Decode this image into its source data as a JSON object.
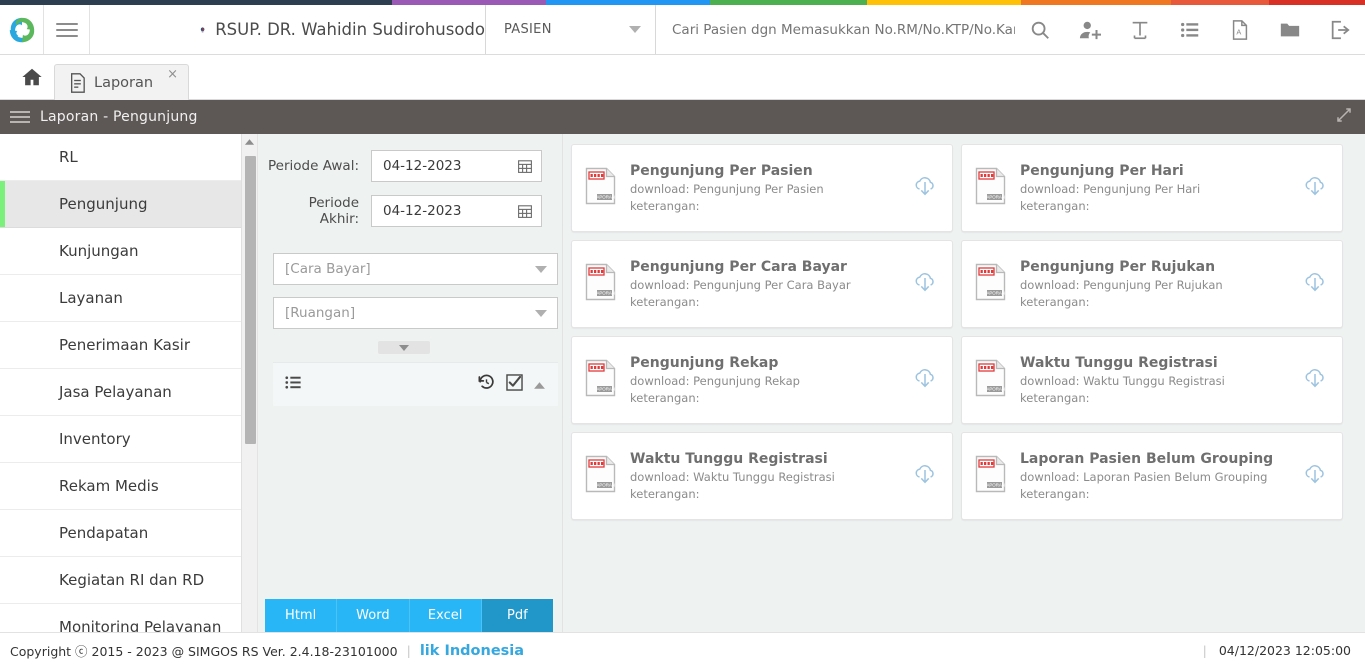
{
  "top_stripe_colors": [
    "#2c3e50",
    "#9b59b6",
    "#2196f3",
    "#4caf50",
    "#ffc107",
    "#ef7721",
    "#e8593c",
    "#d93025"
  ],
  "header": {
    "logo": "simgos-pinwheel-logo",
    "menu_toggle": "hamburger-icon",
    "hospital_name": "RSUP. DR. Wahidin Sudirohusodo",
    "search_category": "PASIEN",
    "search_placeholder": "Cari Pasien dgn Memasukkan No.RM/No.KTP/No.Kartu BPJS/",
    "icons": [
      {
        "name": "search-icon",
        "glyph": "search"
      },
      {
        "name": "add-user-icon",
        "glyph": "user-plus"
      },
      {
        "name": "text-tool-icon",
        "glyph": "text"
      },
      {
        "name": "list-icon",
        "glyph": "list"
      },
      {
        "name": "pdf-icon",
        "glyph": "pdf"
      },
      {
        "name": "folder-icon",
        "glyph": "folder"
      },
      {
        "name": "logout-icon",
        "glyph": "logout"
      }
    ]
  },
  "tabbar": {
    "home_icon": "home-icon",
    "tabs": [
      {
        "label": "Laporan",
        "icon": "document-icon",
        "close": "×",
        "active": true
      }
    ]
  },
  "breadcrumb": {
    "menu_icon": "hamburger-icon",
    "text": "Laporan - Pengunjung",
    "expand_icon": "expand-icon"
  },
  "sidebar": {
    "items": [
      {
        "label": "RL",
        "active": false
      },
      {
        "label": "Pengunjung",
        "active": true
      },
      {
        "label": "Kunjungan",
        "active": false
      },
      {
        "label": "Layanan",
        "active": false
      },
      {
        "label": "Penerimaan Kasir",
        "active": false
      },
      {
        "label": "Jasa Pelayanan",
        "active": false
      },
      {
        "label": "Inventory",
        "active": false
      },
      {
        "label": "Rekam Medis",
        "active": false
      },
      {
        "label": "Pendapatan",
        "active": false
      },
      {
        "label": "Kegiatan RI dan RD",
        "active": false
      },
      {
        "label": "Monitoring Pelayanan",
        "active": false
      }
    ],
    "active_accent_color": "#7bf07b",
    "scrollbar": {
      "up_icon": "chevron-up-icon",
      "down_icon": "chevron-down-icon"
    }
  },
  "filters": {
    "periode_awal_label": "Periode Awal:",
    "periode_awal_value": "04-12-2023",
    "periode_akhir_label": "Periode Akhir:",
    "periode_akhir_value": "04-12-2023",
    "calendar_icon": "calendar-icon",
    "cara_bayar_value": "[Cara Bayar]",
    "ruangan_value": "[Ruangan]",
    "dropdown_icon": "chevron-down-icon",
    "drag_handle_icon": "chevron-down-icon",
    "toolbar": {
      "list_icon": "list-icon",
      "reset_icon": "history-reset-icon",
      "check_icon": "checkbox-checked-icon",
      "collapse_icon": "chevron-up-icon"
    },
    "export_buttons": [
      {
        "label": "Html",
        "active": false
      },
      {
        "label": "Word",
        "active": false
      },
      {
        "label": "Excel",
        "active": false
      },
      {
        "label": "Pdf",
        "active": true
      }
    ]
  },
  "reports": {
    "download_prefix": "download: ",
    "keterangan_label": "keterangan:",
    "doc_icon": "report-document-icon",
    "download_icon": "cloud-download-icon",
    "cards": [
      {
        "title": "Pengunjung Per Pasien",
        "download": "download: Pengunjung Per Pasien",
        "keterangan": "keterangan:"
      },
      {
        "title": "Pengunjung Per Hari",
        "download": "download: Pengunjung Per Hari",
        "keterangan": "keterangan:"
      },
      {
        "title": "Pengunjung Per Cara Bayar",
        "download": "download: Pengunjung Per Cara Bayar",
        "keterangan": "keterangan:"
      },
      {
        "title": "Pengunjung Per Rujukan",
        "download": "download: Pengunjung Per Rujukan",
        "keterangan": "keterangan:"
      },
      {
        "title": "Pengunjung Rekap",
        "download": "download: Pengunjung Rekap",
        "keterangan": "keterangan:"
      },
      {
        "title": "Waktu Tunggu Registrasi",
        "download": "download: Waktu Tunggu Registrasi",
        "keterangan": "keterangan:"
      },
      {
        "title": "Waktu Tunggu Registrasi",
        "download": "download: Waktu Tunggu Registrasi",
        "keterangan": "keterangan:"
      },
      {
        "title": "Laporan Pasien Belum Grouping",
        "download": "download: Laporan Pasien Belum Grouping",
        "keterangan": "keterangan:"
      }
    ]
  },
  "footer": {
    "copyright": "Copyright ⓒ 2015 - 2023 @ SIMGOS RS Ver. 2.4.18-23101000",
    "brand": "lik Indonesia",
    "datetime": "04/12/2023 12:05:00"
  }
}
